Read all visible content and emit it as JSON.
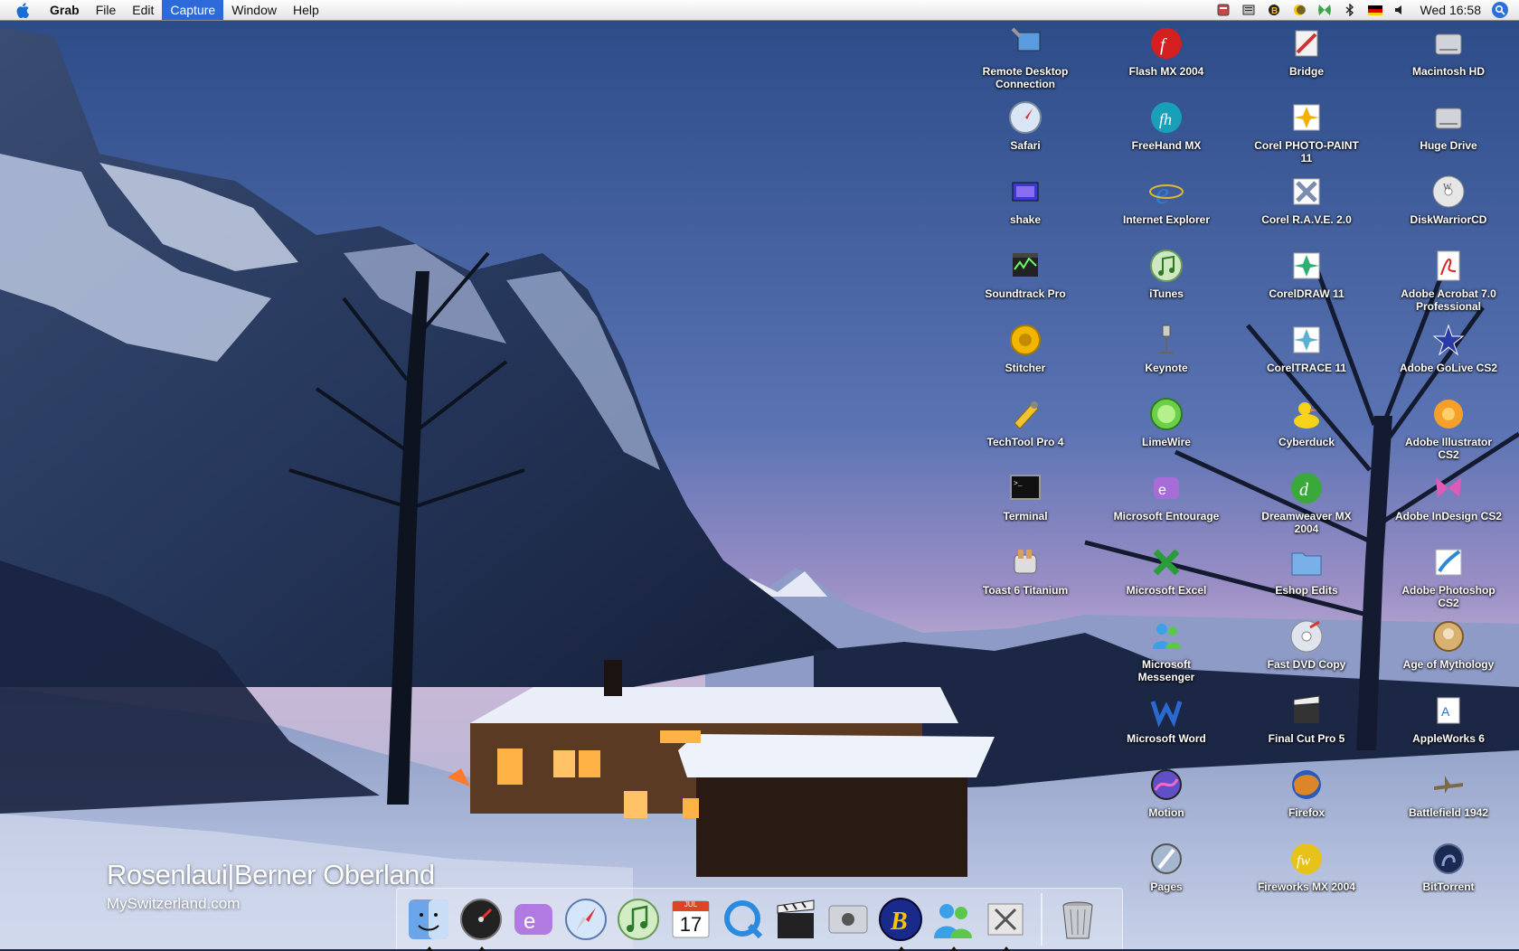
{
  "menubar": {
    "app_name": "Grab",
    "items": [
      "File",
      "Edit",
      "Capture",
      "Window",
      "Help"
    ],
    "active_item": "Capture",
    "clock": "Wed 16:58",
    "status_icons": [
      "script-icon",
      "note-icon",
      "b-icon",
      "sun-icon",
      "butterfly-icon",
      "bluetooth-icon",
      "german-flag-icon",
      "volume-icon"
    ]
  },
  "desktop": {
    "columns": [
      [
        "Remote Desktop Connection",
        "Safari",
        "shake",
        "Soundtrack Pro",
        "Stitcher",
        "TechTool Pro 4",
        "Terminal",
        "Toast 6 Titanium"
      ],
      [
        "Flash MX 2004",
        "FreeHand MX",
        "Internet Explorer",
        "iTunes",
        "Keynote",
        "LimeWire",
        "Microsoft Entourage",
        "Microsoft Excel",
        "Microsoft Messenger",
        "Microsoft Word",
        "Motion",
        "Pages"
      ],
      [
        "Bridge",
        "Corel PHOTO-PAINT 11",
        "Corel R.A.V.E. 2.0",
        "CorelDRAW 11",
        "CorelTRACE 11",
        "Cyberduck",
        "Dreamweaver MX 2004",
        "Eshop Edits",
        "Fast DVD Copy",
        "Final Cut Pro 5",
        "Firefox",
        "Fireworks MX 2004"
      ],
      [
        "Macintosh HD",
        "Huge Drive",
        "DiskWarriorCD",
        "Adobe Acrobat 7.0 Professional",
        "Adobe GoLive CS2",
        "Adobe Illustrator CS2",
        "Adobe InDesign CS2",
        "Adobe Photoshop CS2",
        "Age of Mythology",
        "AppleWorks 6",
        "Battlefield 1942",
        "BitTorrent"
      ]
    ]
  },
  "wallpaper": {
    "title": "Rosenlaui|Berner Oberland",
    "url": "MySwitzerland.com"
  },
  "dock": {
    "items": [
      "finder-icon",
      "dashboard-icon",
      "mail-icon",
      "safari-icon",
      "itunes-icon",
      "ical-icon",
      "quicktime-icon",
      "final-cut-icon",
      "apple-icon",
      "bbedit-icon",
      "messenger-icon",
      "grab-icon"
    ],
    "running": [
      "finder-icon",
      "dashboard-icon",
      "bbedit-icon",
      "messenger-icon",
      "grab-icon"
    ],
    "trash": "trash-icon",
    "calendar_date": "17",
    "calendar_month": "JUL"
  },
  "colors": {
    "menu_highlight": "#2d6ad9",
    "sky_top": "#2e4f8c",
    "sky_horizon": "#8a8ac4",
    "snow": "#dfe6f2",
    "window_light": "#ffb347"
  }
}
